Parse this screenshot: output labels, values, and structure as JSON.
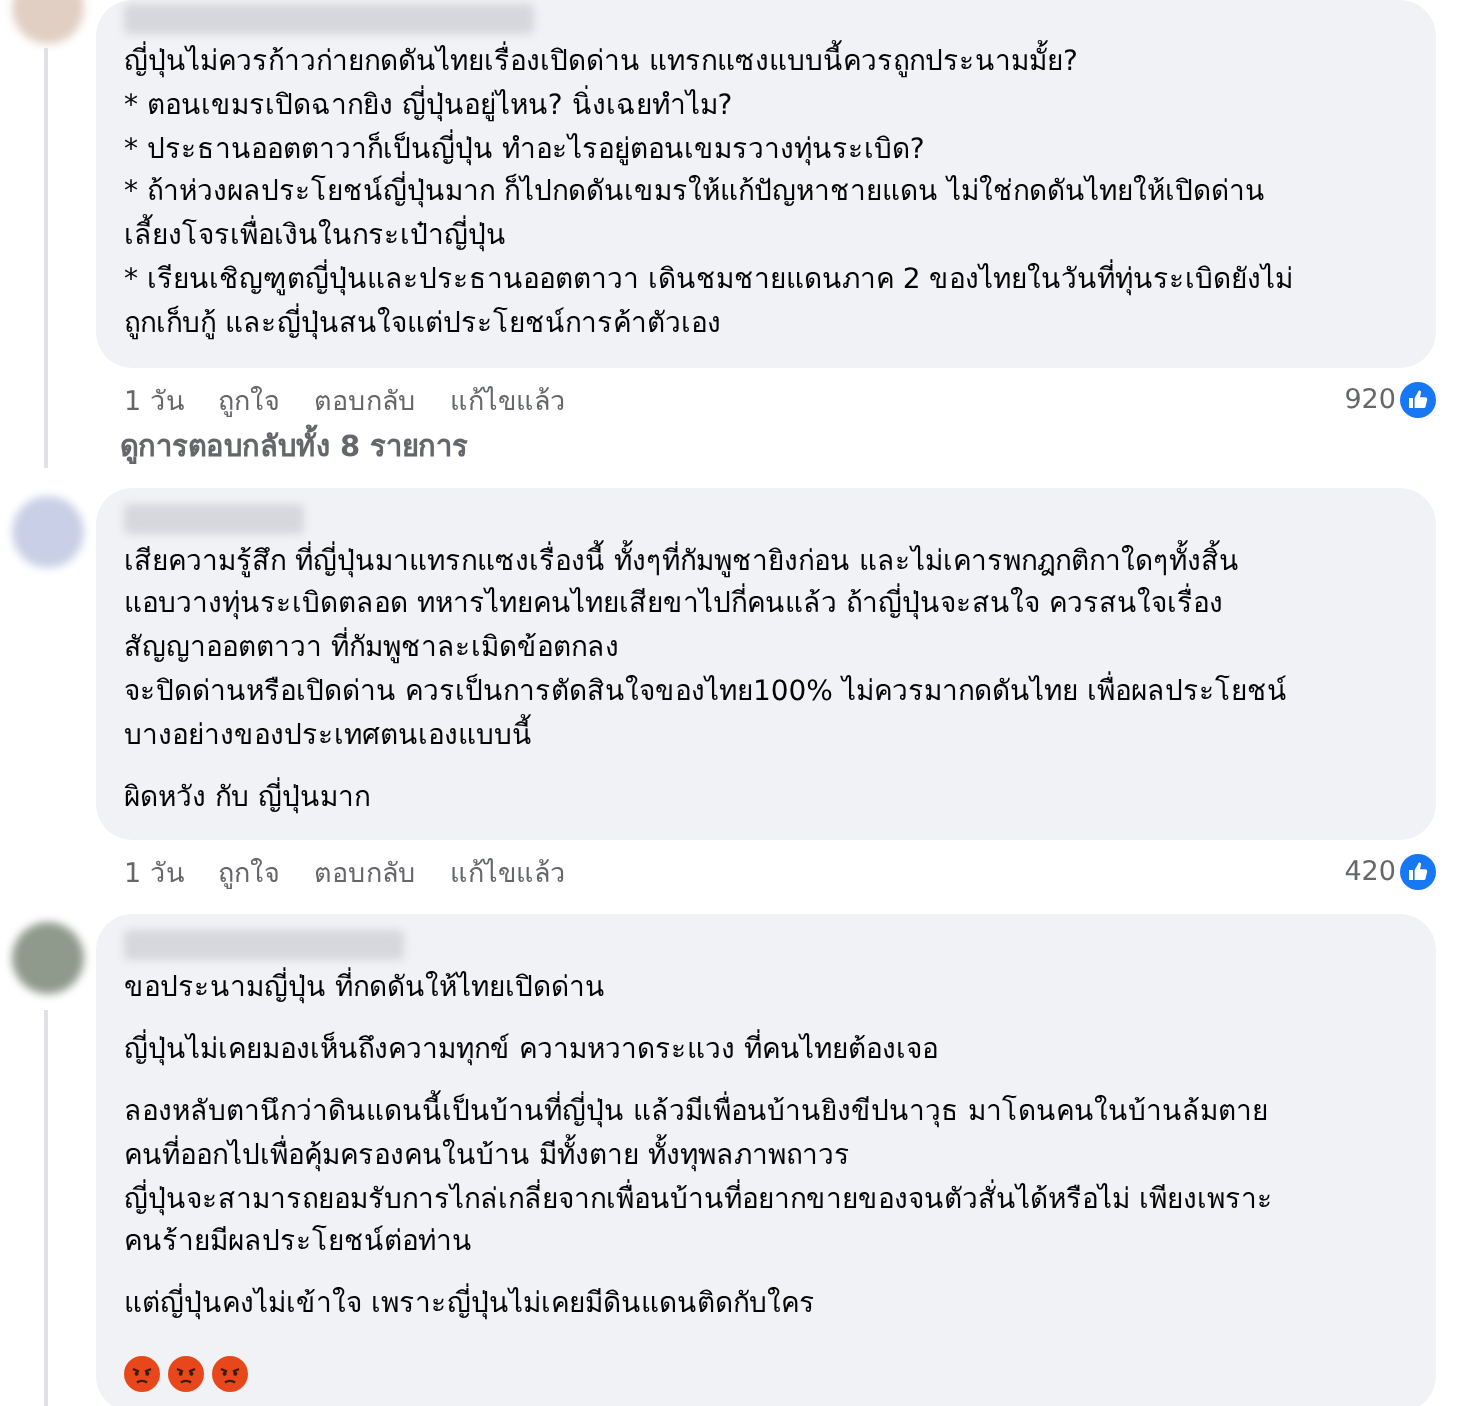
{
  "comments": [
    {
      "paragraphs": [
        "ญี่ปุ่นไม่ควรก้าวก่ายกดดันไทยเรื่องเปิดด่าน แทรกแซงแบบนี้ควรถูกประนามมั้ย?\n* ตอนเขมรเปิดฉากยิง ญี่ปุ่นอยู่ไหน? นิ่งเฉยทำไม?\n* ประธานออตตาวาก็เป็นญี่ปุ่น ทำอะไรอยู่ตอนเขมรวางทุ่นระเบิด?\n* ถ้าห่วงผลประโยชน์ญี่ปุ่นมาก ก็ไปกดดันเขมรให้แก้ปัญหาชายแดน ไม่ใช่กดดันไทยให้เปิดด่าน\nเลี้ยงโจรเพื่อเงินในกระเป๋าญี่ปุ่น\n* เรียนเชิญฑูตญี่ปุ่นและประธานออตตาวา เดินชมชายแดนภาค 2 ของไทยในวันที่ทุ่นระเบิดยังไม่\nถูกเก็บกู้ และญี่ปุ่นสนใจแต่ประโยชน์การค้าตัวเอง"
      ],
      "actions": [
        "1 วัน",
        "ถูกใจ",
        "ตอบกลับ",
        "แก้ไขแล้ว"
      ],
      "reaction_count": "920",
      "replies_link": "ดูการตอบกลับทั้ง 8 รายการ"
    },
    {
      "paragraphs": [
        "เสียความรู้สึก ที่ญี่ปุ่นมาแทรกแซงเรื่องนี้ ทั้งๆที่กัมพูชายิงก่อน และไม่เคารพกฎกติกาใดๆทั้งสิ้น\nแอบวางทุ่นระเบิดตลอด ทหารไทยคนไทยเสียขาไปกี่คนแล้ว ถ้าญี่ปุ่นจะสนใจ ควรสนใจเรื่อง\nสัญญาออตตาวา ที่กัมพูชาละเมิดข้อตกลง\nจะปิดด่านหรือเปิดด่าน ควรเป็นการตัดสินใจของไทย100% ไม่ควรมากดดันไทย เพื่อผลประโยชน์\nบางอย่างของประเทศตนเองแบบนี้",
        "ผิดหวัง กับ ญี่ปุ่นมาก"
      ],
      "actions": [
        "1 วัน",
        "ถูกใจ",
        "ตอบกลับ",
        "แก้ไขแล้ว"
      ],
      "reaction_count": "420"
    },
    {
      "paragraphs": [
        "ขอประนามญี่ปุ่น ที่กดดันให้ไทยเปิดด่าน",
        "ญี่ปุ่นไม่เคยมองเห็นถึงความทุกข์ ความหวาดระแวง ที่คนไทยต้องเจอ",
        "ลองหลับตานึกว่าดินแดนนี้เป็นบ้านที่ญี่ปุ่น แล้วมีเพื่อนบ้านยิงขีปนาวุธ มาโดนคนในบ้านล้มตาย\nคนที่ออกไปเพื่อคุ้มครองคนในบ้าน มีทั้งตาย ทั้งทุพลภาพถาวร\nญี่ปุ่นจะสามารถยอมรับการไกล่เกลี่ยจากเพื่อนบ้านที่อยากขายของจนตัวสั่นได้หรือไม่ เพียงเพราะ\nคนร้ายมีผลประโยชน์ต่อท่าน",
        "แต่ญี่ปุ่นคงไม่เข้าใจ เพราะญี่ปุ่นไม่เคยมีดินแดนติดกับใคร"
      ],
      "emojis": [
        {
          "kind": "angry"
        },
        {
          "kind": "angry"
        },
        {
          "kind": "angry"
        }
      ]
    }
  ]
}
